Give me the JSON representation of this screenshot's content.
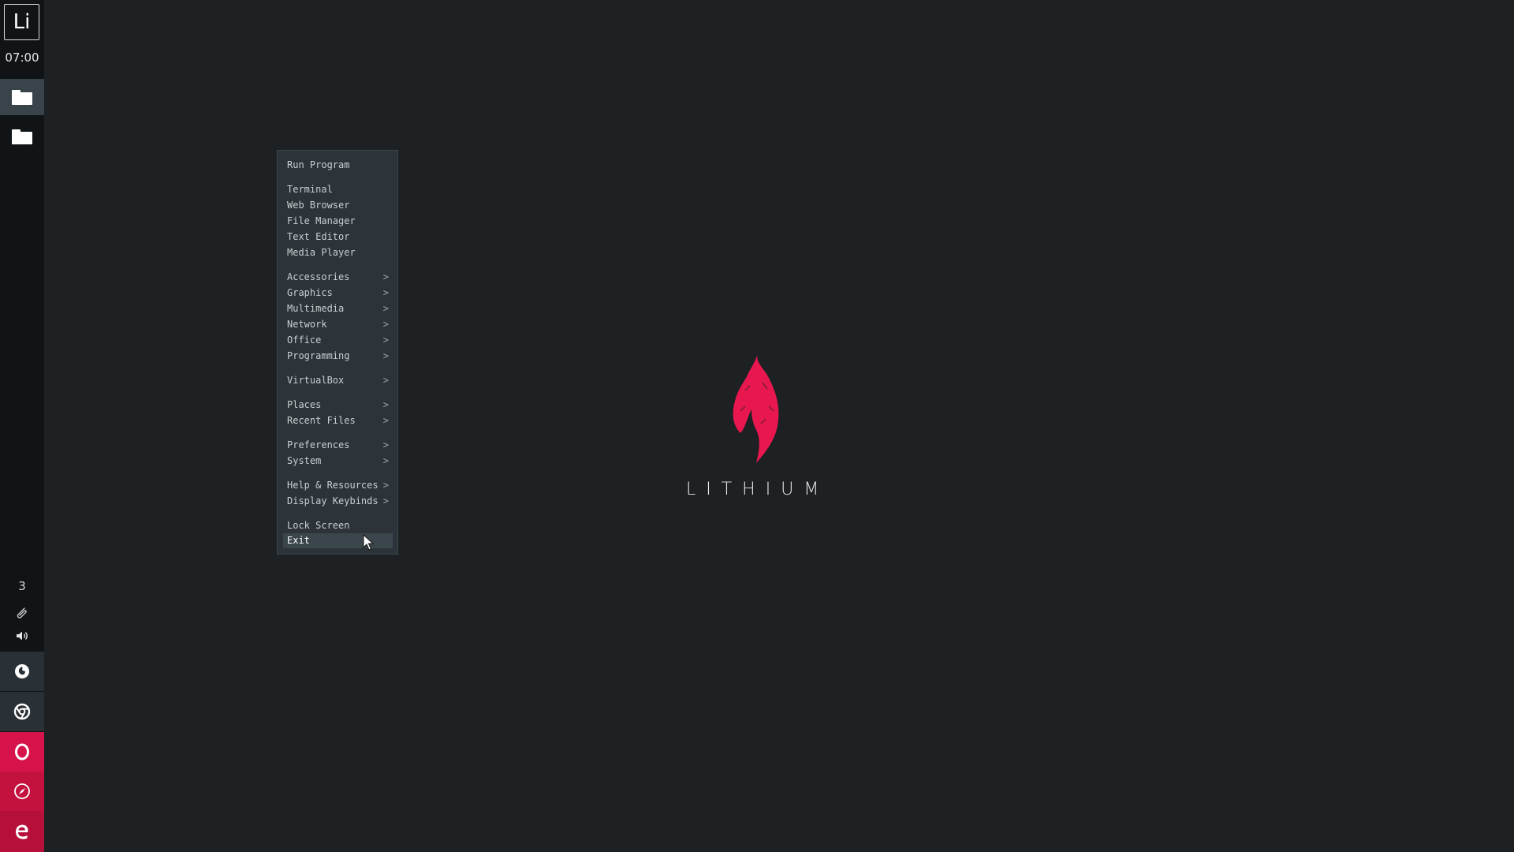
{
  "panel": {
    "logo_text": "Li",
    "clock": "07:00",
    "tray_count": "3",
    "workspaces": [
      {
        "name": "workspace-1",
        "active": true
      },
      {
        "name": "workspace-2",
        "active": false
      }
    ],
    "launchers": [
      {
        "icon": "firefox-icon",
        "color": "#2a3136"
      },
      {
        "icon": "chrome-icon",
        "color": "#2a3136"
      },
      {
        "icon": "opera-icon",
        "color": "#d6134a"
      },
      {
        "icon": "safari-icon",
        "color": "#c4123f"
      },
      {
        "icon": "edge-icon",
        "color": "#b60f3a"
      }
    ]
  },
  "menu": {
    "items": [
      {
        "label": "Run Program",
        "submenu": false
      },
      {
        "label": "Terminal",
        "submenu": false
      },
      {
        "label": "Web Browser",
        "submenu": false
      },
      {
        "label": "File Manager",
        "submenu": false
      },
      {
        "label": "Text Editor",
        "submenu": false
      },
      {
        "label": "Media Player",
        "submenu": false
      },
      {
        "label": "Accessories",
        "submenu": true
      },
      {
        "label": "Graphics",
        "submenu": true
      },
      {
        "label": "Multimedia",
        "submenu": true
      },
      {
        "label": "Network",
        "submenu": true
      },
      {
        "label": "Office",
        "submenu": true
      },
      {
        "label": "Programming",
        "submenu": true
      },
      {
        "label": "VirtualBox",
        "submenu": true
      },
      {
        "label": "Places",
        "submenu": true
      },
      {
        "label": "Recent Files",
        "submenu": true
      },
      {
        "label": "Preferences",
        "submenu": true
      },
      {
        "label": "System",
        "submenu": true
      },
      {
        "label": "Help & Resources",
        "submenu": true
      },
      {
        "label": "Display Keybinds",
        "submenu": true
      },
      {
        "label": "Lock Screen",
        "submenu": false
      },
      {
        "label": "Exit",
        "submenu": false,
        "highlighted": true
      }
    ],
    "submenu_arrow": ">"
  },
  "wallpaper": {
    "brand": "LITHIUM",
    "accent_color": "#e8174f",
    "background_color": "#1d2124"
  }
}
